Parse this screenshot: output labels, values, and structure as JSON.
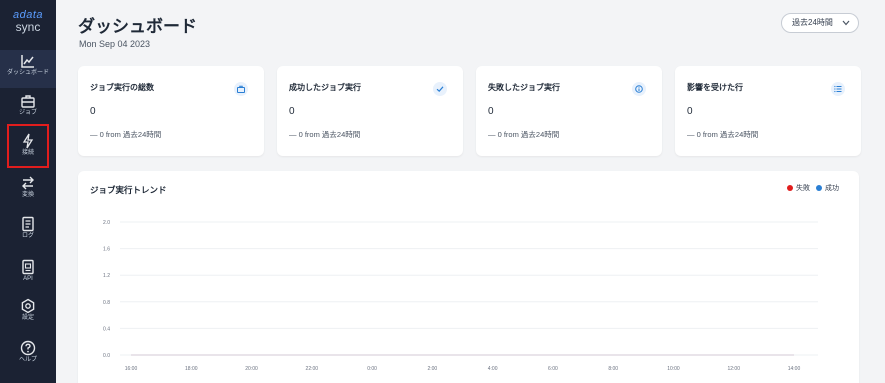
{
  "sidebar": {
    "brand_top": "adata",
    "brand_sub": "sync",
    "items": [
      {
        "label": "ダッシュボード",
        "icon": "line-chart-icon"
      },
      {
        "label": "ジョブ",
        "icon": "briefcase-icon"
      },
      {
        "label": "接続",
        "icon": "lightning-icon"
      },
      {
        "label": "変換",
        "icon": "swap-arrows-icon"
      },
      {
        "label": "ログ",
        "icon": "log-file-icon"
      },
      {
        "label": "API",
        "icon": "api-file-icon"
      },
      {
        "label": "設定",
        "icon": "gear-icon"
      },
      {
        "label": "ヘルプ",
        "icon": "help-icon"
      }
    ]
  },
  "header": {
    "title": "ダッシュボード",
    "date": "Mon Sep 04 2023",
    "range_select": "過去24時間"
  },
  "cards": [
    {
      "title": "ジョブ実行の総数",
      "value": "0",
      "delta": "— 0 from 過去24時間",
      "icon": "briefcase-icon"
    },
    {
      "title": "成功したジョブ実行",
      "value": "0",
      "delta": "— 0 from 過去24時間",
      "icon": "check-icon"
    },
    {
      "title": "失敗したジョブ実行",
      "value": "0",
      "delta": "— 0 from 過去24時間",
      "icon": "info-circle-icon"
    },
    {
      "title": "影響を受けた行",
      "value": "0",
      "delta": "— 0 from 過去24時間",
      "icon": "list-icon"
    }
  ],
  "colors": {
    "sidebar_bg": "#1b2233",
    "accent": "#2a7fd4",
    "fail": "#e11d1d",
    "success": "#2a7fd4"
  },
  "chart_data": {
    "type": "line",
    "title": "ジョブ実行トレンド",
    "x": [
      "16:00",
      "18:00",
      "20:00",
      "22:00",
      "0:00",
      "2:00",
      "4:00",
      "6:00",
      "8:00",
      "10:00",
      "12:00",
      "14:00"
    ],
    "y_ticks": [
      "2.0",
      "1.6",
      "1.2",
      "0.8",
      "0.4",
      "0.0"
    ],
    "ylim": [
      0,
      2
    ],
    "grid": true,
    "legend_position": "top-right",
    "series": [
      {
        "name": "失敗",
        "color": "#e11d1d",
        "values": [
          0,
          0,
          0,
          0,
          0,
          0,
          0,
          0,
          0,
          0,
          0,
          0
        ]
      },
      {
        "name": "成功",
        "color": "#2a7fd4",
        "values": [
          0,
          0,
          0,
          0,
          0,
          0,
          0,
          0,
          0,
          0,
          0,
          0
        ]
      }
    ]
  }
}
